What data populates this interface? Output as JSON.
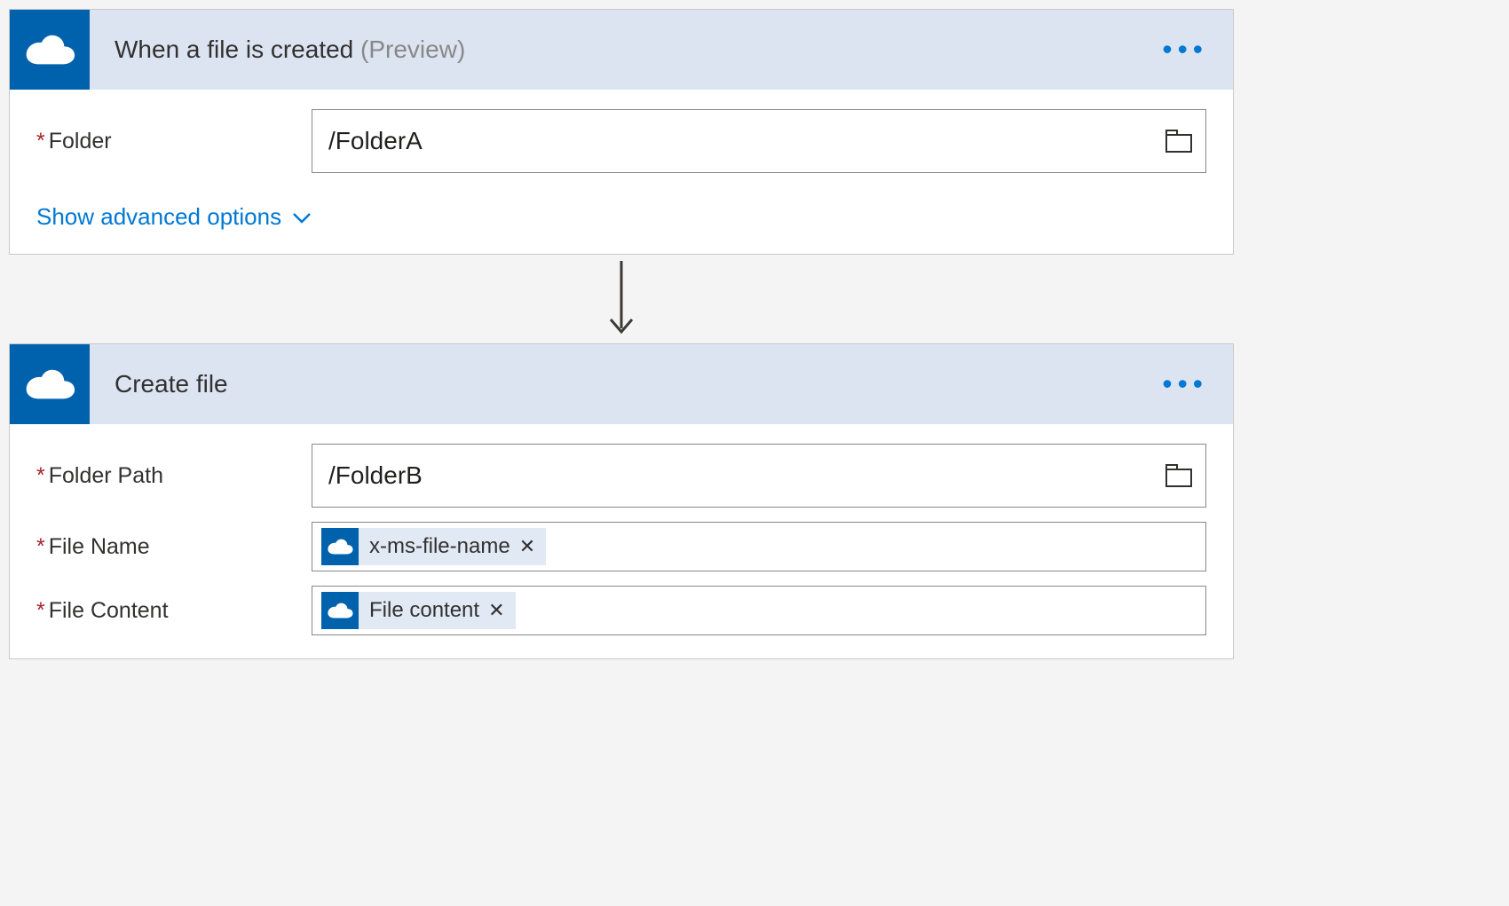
{
  "trigger": {
    "title": "When a file is created",
    "suffix": "(Preview)",
    "fields": {
      "folder": {
        "label": "Folder",
        "value": "/FolderA"
      }
    },
    "advancedLink": "Show advanced options"
  },
  "action": {
    "title": "Create file",
    "fields": {
      "folderPath": {
        "label": "Folder Path",
        "value": "/FolderB"
      },
      "fileName": {
        "label": "File Name",
        "token": "x-ms-file-name"
      },
      "fileContent": {
        "label": "File Content",
        "token": "File content"
      }
    }
  }
}
